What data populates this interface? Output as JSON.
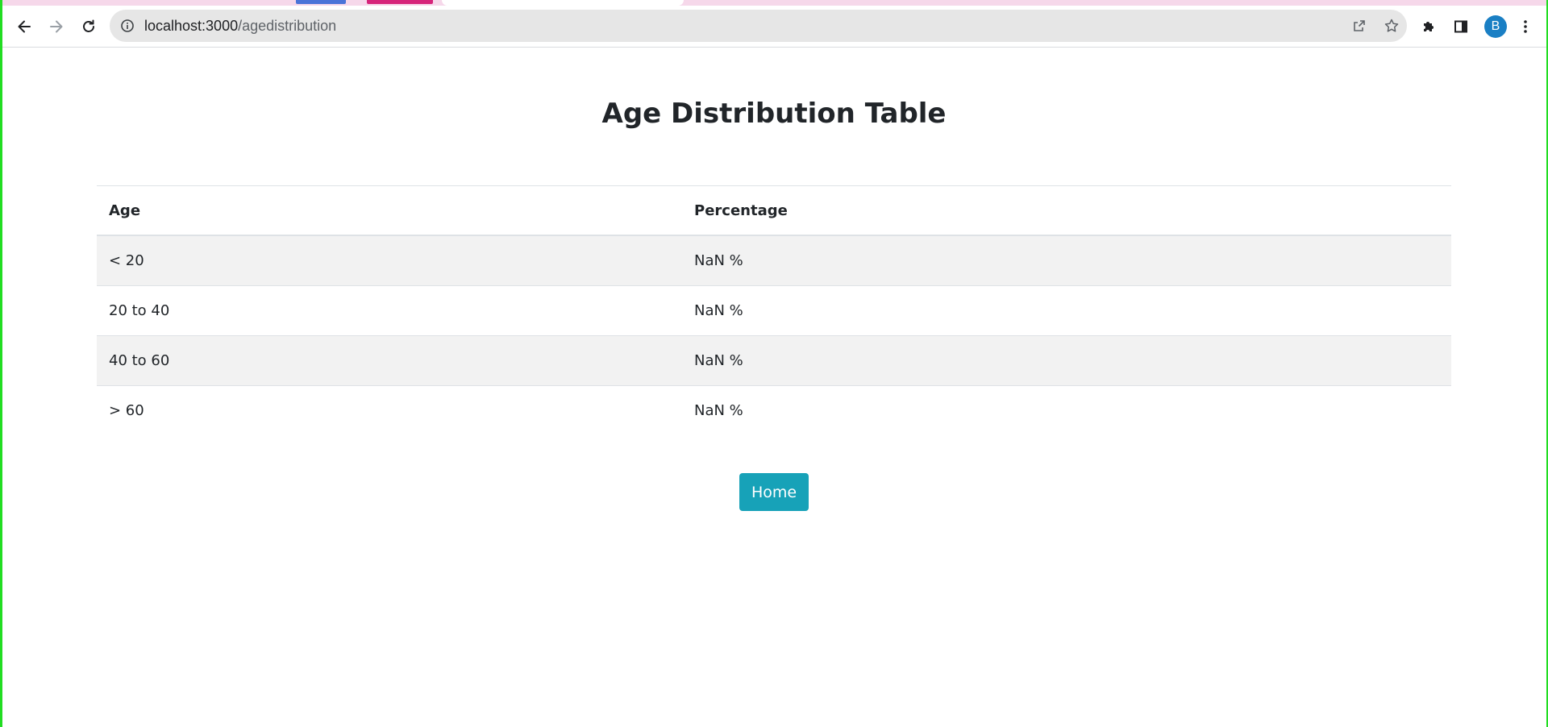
{
  "browser": {
    "url_host": "localhost:3000",
    "url_path": "/agedistribution",
    "profile_initial": "B"
  },
  "page": {
    "title": "Age Distribution Table",
    "table": {
      "headers": [
        "Age",
        "Percentage"
      ],
      "rows": [
        {
          "age": "< 20",
          "percentage": "NaN %"
        },
        {
          "age": "20 to 40",
          "percentage": "NaN %"
        },
        {
          "age": "40 to 60",
          "percentage": "NaN %"
        },
        {
          "age": "> 60",
          "percentage": "NaN %"
        }
      ]
    },
    "home_button": "Home"
  },
  "colors": {
    "button": "#17a2b8",
    "striped_row": "#f2f2f2",
    "avatar": "#1a7fc4"
  },
  "icons": [
    "back-arrow-icon",
    "forward-arrow-icon",
    "reload-icon",
    "info-icon",
    "share-icon",
    "star-icon",
    "extensions-icon",
    "side-panel-icon",
    "more-vert-icon"
  ]
}
